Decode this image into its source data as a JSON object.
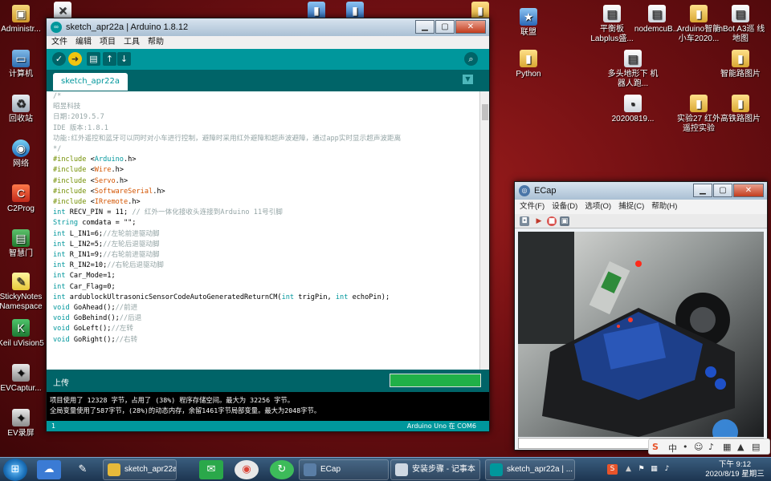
{
  "desktop": {
    "left_icons": [
      {
        "label": "Administr...",
        "icon": "folder-user-icon",
        "glyph": "▣",
        "cls": "ico-admin"
      },
      {
        "label": "计算机",
        "icon": "computer-icon",
        "glyph": "▭",
        "cls": "ico-pc"
      },
      {
        "label": "回收站",
        "icon": "recycle-bin-icon",
        "glyph": "♻",
        "cls": "ico-trash"
      },
      {
        "label": "网络",
        "icon": "network-icon",
        "glyph": "◉",
        "cls": "ico-net"
      },
      {
        "label": "C2Prog",
        "icon": "c2prog-icon",
        "glyph": "C",
        "cls": "ico-c2"
      },
      {
        "label": "智慧门",
        "icon": "smart-door-icon",
        "glyph": "▤",
        "cls": "ico-smart"
      },
      {
        "label": "StickyNotes Namespace",
        "icon": "sticky-notes-icon",
        "glyph": "✎",
        "cls": "ico-sticky"
      },
      {
        "label": "Keil uVision5",
        "icon": "keil-icon",
        "glyph": "K",
        "cls": "ico-keil"
      },
      {
        "label": "EVCaptur...",
        "icon": "evcapture-icon",
        "glyph": "✦",
        "cls": "ico-ev"
      },
      {
        "label": "EV录屏",
        "icon": "ev-recorder-icon",
        "glyph": "✦",
        "cls": "ico-ev"
      }
    ],
    "top_icons": [
      {
        "label": "",
        "icon": "tools-icon",
        "glyph": "✕",
        "cls": "ico-doc"
      },
      {
        "label": "",
        "icon": "blue-app-icon",
        "glyph": "▮",
        "cls": "ico-blue"
      },
      {
        "label": "",
        "icon": "blue-app-icon",
        "glyph": "▮",
        "cls": "ico-blue"
      },
      {
        "label": "",
        "icon": "folder-icon",
        "glyph": "▮",
        "cls": "ico-folder"
      }
    ],
    "right_icons": [
      {
        "label": "联盟",
        "icon": "app-icon",
        "glyph": "★",
        "cls": "ico-blue"
      },
      {
        "label": "平衡板 Labplus盛...",
        "icon": "labplus-icon",
        "glyph": "▤",
        "cls": "ico-doc"
      },
      {
        "label": "nodemcuB...",
        "icon": "document-icon",
        "glyph": "▤",
        "cls": "ico-doc"
      },
      {
        "label": "Arduino智能 小车2020...",
        "icon": "folder-icon",
        "glyph": "▮",
        "cls": "ico-folder"
      },
      {
        "label": "mBot A3巡 线地图",
        "icon": "document-icon",
        "glyph": "▤",
        "cls": "ico-doc"
      },
      {
        "label": "Python",
        "icon": "folder-icon",
        "glyph": "▮",
        "cls": "ico-folder"
      },
      {
        "label": "多头地形下 机器人跑...",
        "icon": "document-icon",
        "glyph": "▤",
        "cls": "ico-doc"
      },
      {
        "label": "智能路图片",
        "icon": "folder-icon",
        "glyph": "▮",
        "cls": "ico-folder"
      },
      {
        "label": "20200819...",
        "icon": "document-icon",
        "glyph": "▪",
        "cls": "ico-doc"
      },
      {
        "label": "实验27 红外 遥控实验",
        "icon": "folder-icon",
        "glyph": "▮",
        "cls": "ico-folder"
      },
      {
        "label": "高铁路图片",
        "icon": "folder-icon",
        "glyph": "▮",
        "cls": "ico-folder"
      }
    ]
  },
  "arduino": {
    "title": "sketch_apr22a | Arduino 1.8.12",
    "menu": [
      "文件",
      "编辑",
      "项目",
      "工具",
      "帮助"
    ],
    "tab": "sketch_apr22a",
    "code_lines": [
      [
        {
          "t": "/*",
          "c": "c"
        }
      ],
      [
        {
          "t": "昭昱科技",
          "c": "c"
        }
      ],
      [
        {
          "t": "日期:2019.5.7",
          "c": "c"
        }
      ],
      [
        {
          "t": "IDE 版本:1.8.1",
          "c": "c"
        }
      ],
      [
        {
          "t": "功能:红外遥控和蓝牙可以同时对小车进行控制，避障时采用红外避障和超声波避障，通过app实时显示超声波距离",
          "c": "c"
        }
      ],
      [
        {
          "t": "*/",
          "c": "c"
        }
      ],
      [
        {
          "t": "#include",
          "c": "kw"
        },
        {
          "t": " <",
          "c": ""
        },
        {
          "t": "Arduino",
          "c": "ty"
        },
        {
          "t": ".h>",
          "c": ""
        }
      ],
      [
        {
          "t": "#include",
          "c": "kw"
        },
        {
          "t": " <",
          "c": ""
        },
        {
          "t": "Wire",
          "c": "inc"
        },
        {
          "t": ".h>",
          "c": ""
        }
      ],
      [
        {
          "t": "#include",
          "c": "kw"
        },
        {
          "t": " <",
          "c": ""
        },
        {
          "t": "Servo",
          "c": "inc"
        },
        {
          "t": ".h>",
          "c": ""
        }
      ],
      [
        {
          "t": "#include",
          "c": "kw"
        },
        {
          "t": " <",
          "c": ""
        },
        {
          "t": "SoftwareSerial",
          "c": "inc"
        },
        {
          "t": ".h>",
          "c": ""
        }
      ],
      [
        {
          "t": "#include",
          "c": "kw"
        },
        {
          "t": " <",
          "c": ""
        },
        {
          "t": "IRremote",
          "c": "inc"
        },
        {
          "t": ".h>",
          "c": ""
        }
      ],
      [
        {
          "t": "int",
          "c": "ty"
        },
        {
          "t": " RECV_PIN = 11; ",
          "c": ""
        },
        {
          "t": "// 红外一体化接收头连接到Arduino 11号引脚",
          "c": "c"
        }
      ],
      [
        {
          "t": "String",
          "c": "ty"
        },
        {
          "t": " comdata = \"\";",
          "c": ""
        }
      ],
      [
        {
          "t": "int",
          "c": "ty"
        },
        {
          "t": " L_IN1=6;",
          "c": ""
        },
        {
          "t": "//左轮前进驱动脚",
          "c": "c"
        }
      ],
      [
        {
          "t": "int",
          "c": "ty"
        },
        {
          "t": " L_IN2=5;",
          "c": ""
        },
        {
          "t": "//左轮后退驱动脚",
          "c": "c"
        }
      ],
      [
        {
          "t": "int",
          "c": "ty"
        },
        {
          "t": " R_IN1=9;",
          "c": ""
        },
        {
          "t": "//右轮前进驱动脚",
          "c": "c"
        }
      ],
      [
        {
          "t": "int",
          "c": "ty"
        },
        {
          "t": " R_IN2=10;",
          "c": ""
        },
        {
          "t": "//右轮后退驱动脚",
          "c": "c"
        }
      ],
      [
        {
          "t": "int",
          "c": "ty"
        },
        {
          "t": " Car_Mode=1;",
          "c": ""
        }
      ],
      [
        {
          "t": "int",
          "c": "ty"
        },
        {
          "t": " Car_Flag=0;",
          "c": ""
        }
      ],
      [
        {
          "t": "int",
          "c": "ty"
        },
        {
          "t": " ardublockUltrasonicSensorCodeAutoGeneratedReturnCM(",
          "c": ""
        },
        {
          "t": "int",
          "c": "ty"
        },
        {
          "t": " trigPin, ",
          "c": ""
        },
        {
          "t": "int",
          "c": "ty"
        },
        {
          "t": " echoPin);",
          "c": ""
        }
      ],
      [
        {
          "t": "void",
          "c": "ty"
        },
        {
          "t": " GoAhead();",
          "c": ""
        },
        {
          "t": "//前进",
          "c": "c"
        }
      ],
      [
        {
          "t": "void",
          "c": "ty"
        },
        {
          "t": " GoBehind();",
          "c": ""
        },
        {
          "t": "//后退",
          "c": "c"
        }
      ],
      [
        {
          "t": "void",
          "c": "ty"
        },
        {
          "t": " GoLeft();",
          "c": ""
        },
        {
          "t": "//左转",
          "c": "c"
        }
      ],
      [
        {
          "t": "void",
          "c": "ty"
        },
        {
          "t": " GoRight();",
          "c": ""
        },
        {
          "t": "//右转",
          "c": "c"
        }
      ]
    ],
    "status_text": "上传",
    "progress_fraction": 1.0,
    "console_lines": [
      "项目使用了 12328 字节，占用了 (38%) 程序存储空间。最大为 32256 字节。",
      "全局变量使用了587字节，(28%)的动态内存，余留1461字节局部变量。最大为2048字节。"
    ],
    "footer_line": "1",
    "footer_board": "Arduino Uno 在 COM6"
  },
  "ecap": {
    "title": "ECap",
    "menu": [
      "文件(F)",
      "设备(D)",
      "选项(O)",
      "捕捉(C)",
      "帮助(H)"
    ]
  },
  "taskbar": {
    "items": [
      {
        "label": "sketch_apr22a",
        "icon": "folder-icon",
        "bg": "#e6b93a"
      },
      {
        "label": "ECap",
        "icon": "ecap-icon",
        "bg": "#5a7ea6"
      },
      {
        "label": "安装步骤 - 记事本",
        "icon": "notepad-icon",
        "bg": "#cfd8e2"
      },
      {
        "label": "sketch_apr22a | ...",
        "icon": "arduino-icon",
        "bg": "#00979c"
      }
    ],
    "time": "下午 9:12",
    "date": "2020/8/19 星期三"
  },
  "colors": {
    "arduino_teal": "#00979c",
    "arduino_dark": "#006468",
    "progress_green": "#20b048",
    "desktop_red": "#8e1a1d"
  }
}
